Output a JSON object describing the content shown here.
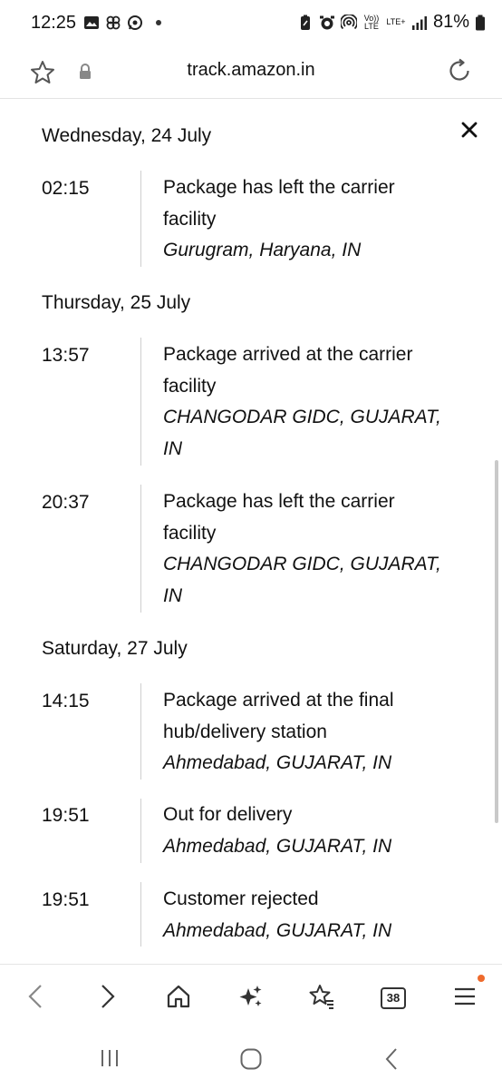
{
  "status_bar": {
    "time": "12:25",
    "battery": "81%",
    "volte": "Vo)) LTE",
    "lte": "LTE+"
  },
  "url_bar": {
    "url": "track.amazon.in"
  },
  "tracking": {
    "days": [
      {
        "date": "Wednesday, 24 July",
        "events": [
          {
            "time": "02:15",
            "line1": "Package has left the carrier",
            "line2": "facility",
            "loc1": "Gurugram, Haryana, IN",
            "loc2": ""
          }
        ]
      },
      {
        "date": "Thursday, 25 July",
        "events": [
          {
            "time": "13:57",
            "line1": "Package arrived at the carrier",
            "line2": "facility",
            "loc1": "CHANGODAR GIDC, GUJARAT,",
            "loc2": "IN"
          },
          {
            "time": "20:37",
            "line1": "Package has left the carrier",
            "line2": "facility",
            "loc1": "CHANGODAR GIDC, GUJARAT,",
            "loc2": "IN"
          }
        ]
      },
      {
        "date": "Saturday, 27 July",
        "events": [
          {
            "time": "14:15",
            "line1": "Package arrived at the final",
            "line2": "hub/delivery station",
            "loc1": "Ahmedabad, GUJARAT, IN",
            "loc2": ""
          },
          {
            "time": "19:51",
            "line1": "Out for delivery",
            "line2": "",
            "loc1": "Ahmedabad, GUJARAT, IN",
            "loc2": ""
          },
          {
            "time": "19:51",
            "line1": "Customer rejected",
            "line2": "",
            "loc1": "Ahmedabad, GUJARAT, IN",
            "loc2": ""
          }
        ]
      }
    ]
  },
  "toolbar": {
    "tab_count": "38",
    "icons": [
      "back-icon",
      "forward-icon",
      "home-icon",
      "sparkle-icon",
      "bookmarks-icon",
      "tabs-icon",
      "menu-icon"
    ]
  },
  "nav_bar": {
    "icons": [
      "recents-icon",
      "home-circle-icon",
      "back-chevron-icon"
    ]
  },
  "colors": {
    "accent_dot": "#ee6a2c",
    "text": "#111111",
    "divider": "#cfcfcf"
  }
}
